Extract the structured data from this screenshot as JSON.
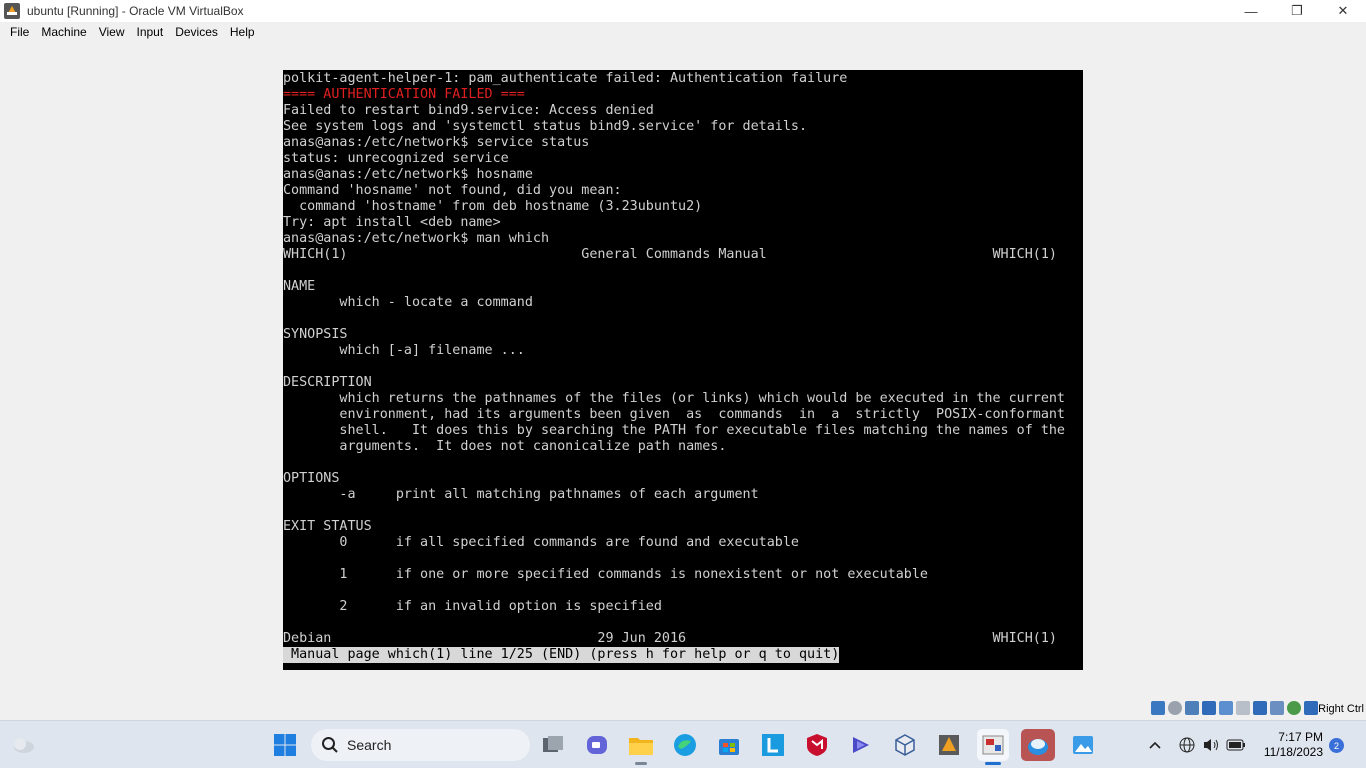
{
  "window": {
    "title": "ubuntu [Running] - Oracle VM VirtualBox",
    "minimize_glyph": "—",
    "restore_glyph": "❐",
    "close_glyph": "✕"
  },
  "menu": [
    "File",
    "Machine",
    "View",
    "Input",
    "Devices",
    "Help"
  ],
  "terminal": {
    "lines": [
      "polkit-agent-helper-1: pam_authenticate failed: Authentication failure",
      "==== AUTHENTICATION FAILED ===",
      "Failed to restart bind9.service: Access denied",
      "See system logs and 'systemctl status bind9.service' for details.",
      "anas@anas:/etc/network$ service status",
      "status: unrecognized service",
      "anas@anas:/etc/network$ hosname",
      "Command 'hosname' not found, did you mean:",
      "  command 'hostname' from deb hostname (3.23ubuntu2)",
      "Try: apt install <deb name>",
      "anas@anas:/etc/network$ man which",
      "WHICH(1)                             General Commands Manual                            WHICH(1)",
      "",
      "NAME",
      "       which - locate a command",
      "",
      "SYNOPSIS",
      "       which [-a] filename ...",
      "",
      "DESCRIPTION",
      "       which returns the pathnames of the files (or links) which would be executed in the current",
      "       environment, had its arguments been given  as  commands  in  a  strictly  POSIX-conformant",
      "       shell.   It does this by searching the PATH for executable files matching the names of the",
      "       arguments.  It does not canonicalize path names.",
      "",
      "OPTIONS",
      "       -a     print all matching pathnames of each argument",
      "",
      "EXIT STATUS",
      "       0      if all specified commands are found and executable",
      "",
      "       1      if one or more specified commands is nonexistent or not executable",
      "",
      "       2      if an invalid option is specified",
      "",
      "Debian                                 29 Jun 2016                                      WHICH(1)"
    ],
    "status_line": " Manual page which(1) line 1/25 (END) (press h for help or q to quit)",
    "error_color": "#e02020"
  },
  "vbox_status": {
    "host_key": "Right Ctrl"
  },
  "taskbar": {
    "search_label": "Search",
    "time": "7:17 PM",
    "date": "11/18/2023",
    "notification_count": "2"
  }
}
